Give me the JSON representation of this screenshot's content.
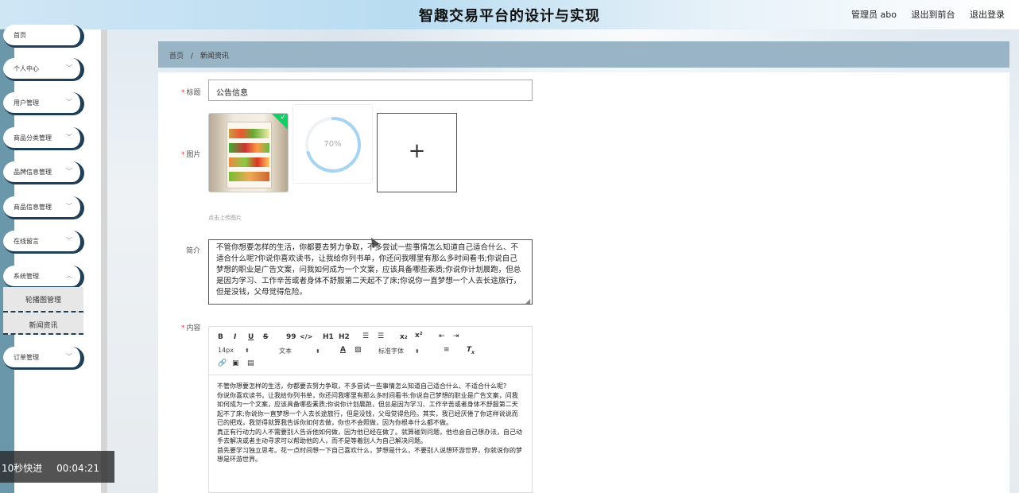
{
  "header": {
    "title": "智趣交易平台的设计与实现",
    "user": "管理员 abo",
    "front_link": "退出到前台",
    "logout_link": "退出登录"
  },
  "sidebar": {
    "items": [
      {
        "label": "首页"
      },
      {
        "label": "个人中心"
      },
      {
        "label": "用户管理"
      },
      {
        "label": "商品分类管理"
      },
      {
        "label": "品牌信息管理"
      },
      {
        "label": "商品信息管理"
      },
      {
        "label": "在线留言"
      },
      {
        "label": "系统管理"
      },
      {
        "label": "订单管理"
      }
    ],
    "submenu": [
      {
        "label": "轮播图管理"
      },
      {
        "label": "新闻资讯"
      }
    ]
  },
  "breadcrumb": {
    "home": "首页",
    "separator": "/",
    "current": "新闻资讯"
  },
  "form": {
    "title_label": "标题",
    "title_value": "公告信息",
    "image_label": "图片",
    "upload_progress": "70%",
    "upload_progress_value": 0.7,
    "upload_hint": "点击上传图片",
    "intro_label": "简介",
    "intro_value": "不管你想要怎样的生活，你都要去努力争取，不多尝试一些事情怎么知道自己适合什么、不适合什么呢?你说你喜欢读书，让我给你列书单，你还问我哪里有那么多时间看书;你说自己梦想的职业是广告文案，问我如何成为一个文案，应该具备哪些素质;你说你计划晨跑，但总是因为学习、工作辛苦或者身体不舒服第二天起不了床;你说你一直梦想一个人去长途旅行，但是没钱，父母觉得危险。",
    "content_label": "内容"
  },
  "editor": {
    "toolbar": {
      "bold": "B",
      "italic": "I",
      "underline": "U",
      "strike": "S",
      "quote": "99",
      "code": "</>",
      "h1": "H1",
      "h2": "H2",
      "sub": "x₂",
      "sup": "x²",
      "size": "14px",
      "text_type": "文本",
      "font": "标准字体"
    },
    "content": "不管你想要怎样的生活，你都要去努力争取，不多尝试一些事情怎么知道自己适合什么、不适合什么呢?\n你说你喜欢读书，让我给你列书单，你还问我哪里有那么多时间看书;你说自己梦想的职业是广告文案，问我如何成为一个文案，应该具备哪些素质;你说你计划晨跑，但总是因为学习、工作辛苦或者身体不舒服第二天起不了床;你说你一直梦想一个人去长途旅行，但是没钱，父母觉得危险。其实，我已经厌倦了你这样说说而已的把戏，我觉得就算我告诉你如何去做，你也不会照做，因为你根本什么都不做。\n真正有行动力的人不需要别人告诉他如何做，因为他已经在做了。就算碰到问题，他也会自己想办法，自己动手去解决或者主动寻求可以帮助他的人，而不是等着别人为自己解决问题。\n首先要学习独立思考。花一点时间想一下自己喜欢什么，梦想是什么，不要别人说想环游世界，你就说你的梦想是环游世界。"
  },
  "overlay": {
    "speed": "10秒快进",
    "time": "00:04:21"
  },
  "colors": {
    "sidebar_accent": "#1e3f57",
    "breadcrumb_bg": "#98b4c5",
    "progress": "#a6d4f2",
    "success": "#13ce66"
  }
}
